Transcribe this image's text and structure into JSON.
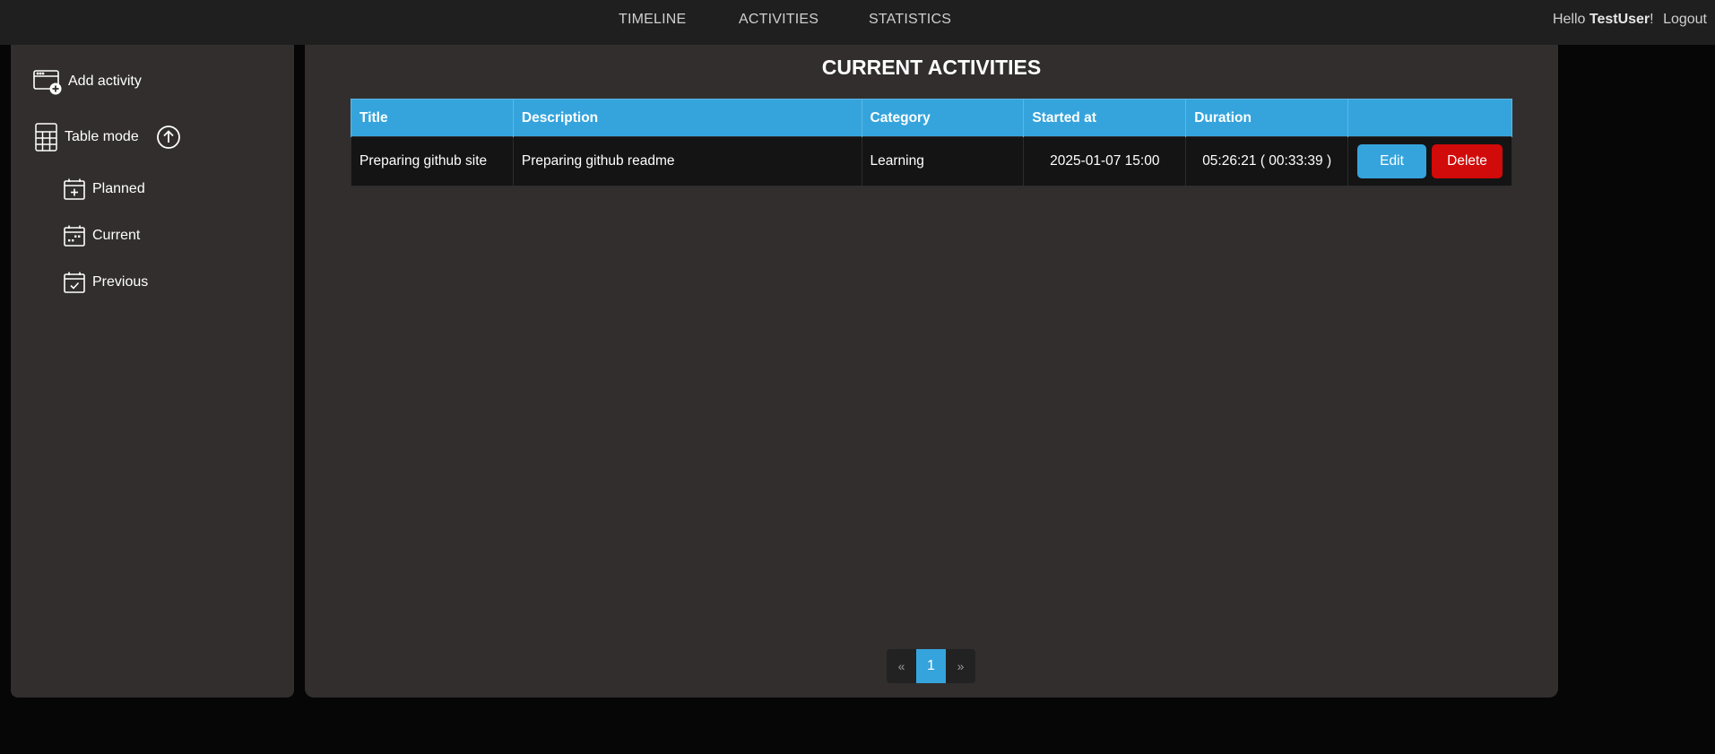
{
  "nav": {
    "links": [
      "TIMELINE",
      "ACTIVITIES",
      "STATISTICS"
    ],
    "greeting_prefix": "Hello",
    "username": "TestUser",
    "greeting_suffix": "!",
    "logout": "Logout"
  },
  "sidebar": {
    "add_activity": "Add activity",
    "table_mode": "Table mode",
    "items": [
      "Planned",
      "Current",
      "Previous"
    ]
  },
  "main": {
    "title": "CURRENT ACTIVITIES",
    "columns": [
      "Title",
      "Description",
      "Category",
      "Started at",
      "Duration",
      ""
    ],
    "rows": [
      {
        "title": "Preparing github site",
        "description": "Preparing github readme",
        "category": "Learning",
        "started_at": "2025-01-07 15:00",
        "duration": "05:26:21 ( 00:33:39 )",
        "edit": "Edit",
        "delete": "Delete"
      }
    ]
  },
  "pagination": {
    "prev": "«",
    "current": "1",
    "next": "»"
  },
  "colors": {
    "accent": "#35a4dc",
    "danger": "#d10a0a",
    "panel": "#322e2e",
    "background": "#060606",
    "topbar": "#1f1f1f"
  }
}
